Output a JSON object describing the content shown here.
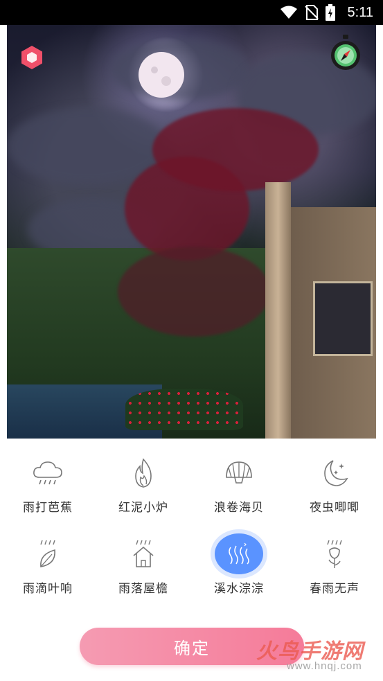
{
  "status_bar": {
    "time": "5:11"
  },
  "sounds": [
    {
      "label": "雨打芭蕉",
      "icon": "cloud-rain-icon",
      "selected": false
    },
    {
      "label": "红泥小炉",
      "icon": "flame-icon",
      "selected": false
    },
    {
      "label": "浪卷海贝",
      "icon": "shell-icon",
      "selected": false
    },
    {
      "label": "夜虫唧唧",
      "icon": "moon-stars-icon",
      "selected": false
    },
    {
      "label": "雨滴叶响",
      "icon": "rain-leaf-icon",
      "selected": false
    },
    {
      "label": "雨落屋檐",
      "icon": "rain-house-icon",
      "selected": false
    },
    {
      "label": "溪水淙淙",
      "icon": "stream-icon",
      "selected": true
    },
    {
      "label": "春雨无声",
      "icon": "rain-flower-icon",
      "selected": false
    }
  ],
  "confirm_label": "确定",
  "watermark": {
    "title": "火鸟手游网",
    "url": "www.hnqj.com"
  },
  "colors": {
    "accent": "#5a93ff",
    "confirm": "#f57b99",
    "hex_button": "#f0506a"
  }
}
